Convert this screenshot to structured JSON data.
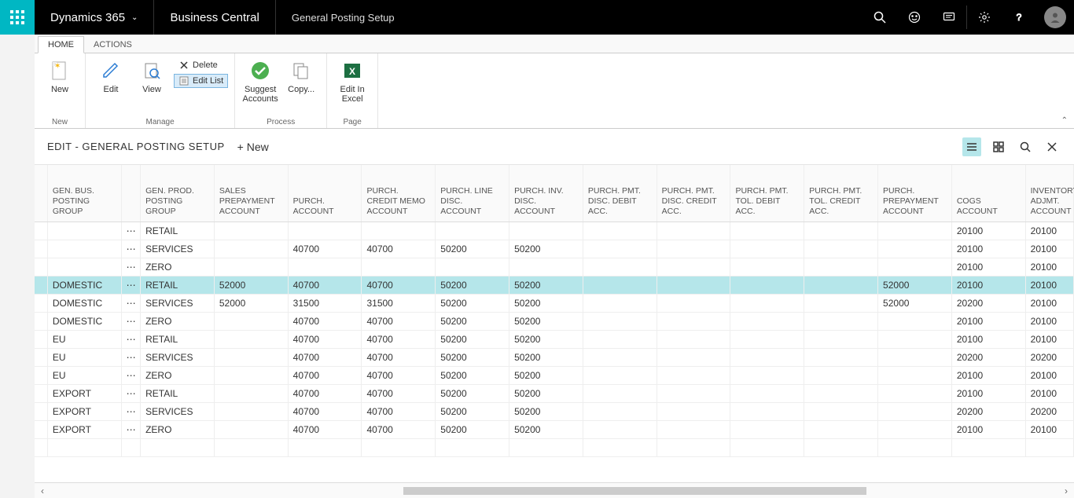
{
  "topbar": {
    "brand": "Dynamics 365",
    "product": "Business Central",
    "breadcrumb": "General Posting Setup"
  },
  "ribbon_tabs": {
    "home": "HOME",
    "actions": "ACTIONS"
  },
  "ribbon": {
    "new": "New",
    "edit": "Edit",
    "view": "View",
    "delete": "Delete",
    "edit_list": "Edit List",
    "suggest_accounts": "Suggest Accounts",
    "copy": "Copy...",
    "edit_in_excel": "Edit In Excel",
    "group_new": "New",
    "group_manage": "Manage",
    "group_process": "Process",
    "group_page": "Page"
  },
  "page": {
    "title": "EDIT - GENERAL POSTING SETUP",
    "new_btn": "+ New"
  },
  "columns": [
    "GEN. BUS. POSTING GROUP",
    "GEN. PROD. POSTING GROUP",
    "SALES PREPAYMENT ACCOUNT",
    "PURCH. ACCOUNT",
    "PURCH. CREDIT MEMO ACCOUNT",
    "PURCH. LINE DISC. ACCOUNT",
    "PURCH. INV. DISC. ACCOUNT",
    "PURCH. PMT. DISC. DEBIT ACC.",
    "PURCH. PMT. DISC. CREDIT ACC.",
    "PURCH. PMT. TOL. DEBIT ACC.",
    "PURCH. PMT. TOL. CREDIT ACC.",
    "PURCH. PREPAYMENT ACCOUNT",
    "COGS ACCOUNT",
    "INVENTORY ADJMT. ACCOUNT"
  ],
  "rows": [
    {
      "gbpg": "",
      "gppg": "RETAIL",
      "sp": "",
      "pa": "",
      "pcm": "",
      "pld": "",
      "pid": "",
      "ppdd": "",
      "ppdc": "",
      "pptd": "",
      "pptc": "",
      "ppa": "",
      "cogs": "20100",
      "inv": "20100"
    },
    {
      "gbpg": "",
      "gppg": "SERVICES",
      "sp": "",
      "pa": "40700",
      "pcm": "40700",
      "pld": "50200",
      "pid": "50200",
      "ppdd": "",
      "ppdc": "",
      "pptd": "",
      "pptc": "",
      "ppa": "",
      "cogs": "20100",
      "inv": "20100"
    },
    {
      "gbpg": "",
      "gppg": "ZERO",
      "sp": "",
      "pa": "",
      "pcm": "",
      "pld": "",
      "pid": "",
      "ppdd": "",
      "ppdc": "",
      "pptd": "",
      "pptc": "",
      "ppa": "",
      "cogs": "20100",
      "inv": "20100"
    },
    {
      "gbpg": "DOMESTIC",
      "gppg": "RETAIL",
      "sp": "52000",
      "pa": "40700",
      "pcm": "40700",
      "pld": "50200",
      "pid": "50200",
      "ppdd": "",
      "ppdc": "",
      "pptd": "",
      "pptc": "",
      "ppa": "52000",
      "cogs": "20100",
      "inv": "20100",
      "selected": true
    },
    {
      "gbpg": "DOMESTIC",
      "gppg": "SERVICES",
      "sp": "52000",
      "pa": "31500",
      "pcm": "31500",
      "pld": "50200",
      "pid": "50200",
      "ppdd": "",
      "ppdc": "",
      "pptd": "",
      "pptc": "",
      "ppa": "52000",
      "cogs": "20200",
      "inv": "20100"
    },
    {
      "gbpg": "DOMESTIC",
      "gppg": "ZERO",
      "sp": "",
      "pa": "40700",
      "pcm": "40700",
      "pld": "50200",
      "pid": "50200",
      "ppdd": "",
      "ppdc": "",
      "pptd": "",
      "pptc": "",
      "ppa": "",
      "cogs": "20100",
      "inv": "20100"
    },
    {
      "gbpg": "EU",
      "gppg": "RETAIL",
      "sp": "",
      "pa": "40700",
      "pcm": "40700",
      "pld": "50200",
      "pid": "50200",
      "ppdd": "",
      "ppdc": "",
      "pptd": "",
      "pptc": "",
      "ppa": "",
      "cogs": "20100",
      "inv": "20100"
    },
    {
      "gbpg": "EU",
      "gppg": "SERVICES",
      "sp": "",
      "pa": "40700",
      "pcm": "40700",
      "pld": "50200",
      "pid": "50200",
      "ppdd": "",
      "ppdc": "",
      "pptd": "",
      "pptc": "",
      "ppa": "",
      "cogs": "20200",
      "inv": "20200"
    },
    {
      "gbpg": "EU",
      "gppg": "ZERO",
      "sp": "",
      "pa": "40700",
      "pcm": "40700",
      "pld": "50200",
      "pid": "50200",
      "ppdd": "",
      "ppdc": "",
      "pptd": "",
      "pptc": "",
      "ppa": "",
      "cogs": "20100",
      "inv": "20100"
    },
    {
      "gbpg": "EXPORT",
      "gppg": "RETAIL",
      "sp": "",
      "pa": "40700",
      "pcm": "40700",
      "pld": "50200",
      "pid": "50200",
      "ppdd": "",
      "ppdc": "",
      "pptd": "",
      "pptc": "",
      "ppa": "",
      "cogs": "20100",
      "inv": "20100"
    },
    {
      "gbpg": "EXPORT",
      "gppg": "SERVICES",
      "sp": "",
      "pa": "40700",
      "pcm": "40700",
      "pld": "50200",
      "pid": "50200",
      "ppdd": "",
      "ppdc": "",
      "pptd": "",
      "pptc": "",
      "ppa": "",
      "cogs": "20200",
      "inv": "20200"
    },
    {
      "gbpg": "EXPORT",
      "gppg": "ZERO",
      "sp": "",
      "pa": "40700",
      "pcm": "40700",
      "pld": "50200",
      "pid": "50200",
      "ppdd": "",
      "ppdc": "",
      "pptd": "",
      "pptc": "",
      "ppa": "",
      "cogs": "20100",
      "inv": "20100"
    }
  ]
}
